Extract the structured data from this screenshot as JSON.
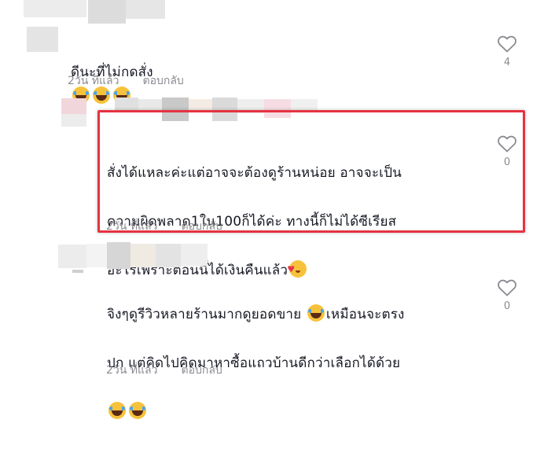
{
  "comments": [
    {
      "text": "ดีนะที่ไม่กดสั่ง",
      "emojis": [
        "laugh-emoji",
        "laugh-emoji",
        "laugh-emoji"
      ],
      "time": "2วัน ที่แล้ว",
      "reply": "ตอบกลับ",
      "likes": "4"
    },
    {
      "line1": "สั่งได้แหละค่ะแต่อาจจะต้องดูร้านหน่อย อาจจะเป็น",
      "line2": "ความผิดพลาด1ใน100ก็ได้ค่ะ ทางนี้ก็ไม่ได้ซีเรียส",
      "line3": "อะไรเพราะตอนนี้ได้เงินคืนแล้ว",
      "emojis": [
        "smiling-face-with-hearts-emoji"
      ],
      "time": "2วัน ที่แล้ว",
      "reply": "ตอบกลับ",
      "likes": "0",
      "highlight_color": "#e53340"
    },
    {
      "line1": "จิงๆดูรีวิวหลายร้านมากดูยอดขาย",
      "line1b": "เหมือนจะตรง",
      "line2": "ปก แต่คิดไปคิดมาหาซื้อแถวบ้านดีกว่าเลือกได้ด้วย",
      "emojis": [
        "laugh-emoji",
        "laugh-emoji",
        "laugh-emoji"
      ],
      "time": "2วัน ที่แล้ว",
      "reply": "ตอบกลับ",
      "likes": "0"
    }
  ],
  "colors": {
    "text": "#161823",
    "muted": "#8a8b91",
    "highlight": "#e53340"
  }
}
